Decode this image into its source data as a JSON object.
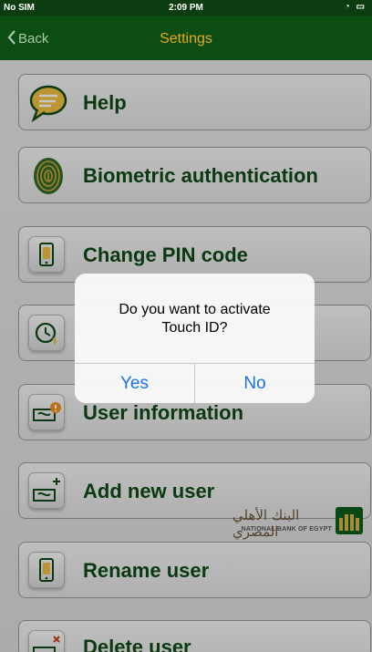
{
  "status_bar": {
    "carrier": "No SIM",
    "time": "2:09 PM",
    "indicators": "◔ ▭"
  },
  "nav": {
    "back_label": "Back",
    "back_icon": "chevron-left-icon",
    "title": "Settings"
  },
  "menu": {
    "items": [
      {
        "label": "Help",
        "icon": "speech-bubble-icon"
      },
      {
        "label": "Biometric authentication",
        "icon": "fingerprint-icon"
      },
      {
        "label": "Change PIN code",
        "icon": "phone-pin-icon"
      },
      {
        "label": "",
        "icon": "clock-add-icon"
      },
      {
        "label": "User information",
        "icon": "user-info-icon"
      },
      {
        "label": "Add new user",
        "icon": "user-add-icon"
      },
      {
        "label": "Rename user",
        "icon": "phone-rename-icon"
      },
      {
        "label": "Delete user",
        "icon": "user-delete-icon"
      }
    ]
  },
  "logo": {
    "arabic": "البنك الأهلي المصري",
    "english": "NATIONAL BANK OF EGYPT"
  },
  "dialog": {
    "message_line1": "Do you want to activate",
    "message_line2": "Touch ID?",
    "yes_label": "Yes",
    "no_label": "No"
  },
  "colors": {
    "nav_bg": "#0b4d12",
    "nav_title": "#e8a81e",
    "item_text": "#0f4a16",
    "dialog_button": "#1a73e8"
  }
}
